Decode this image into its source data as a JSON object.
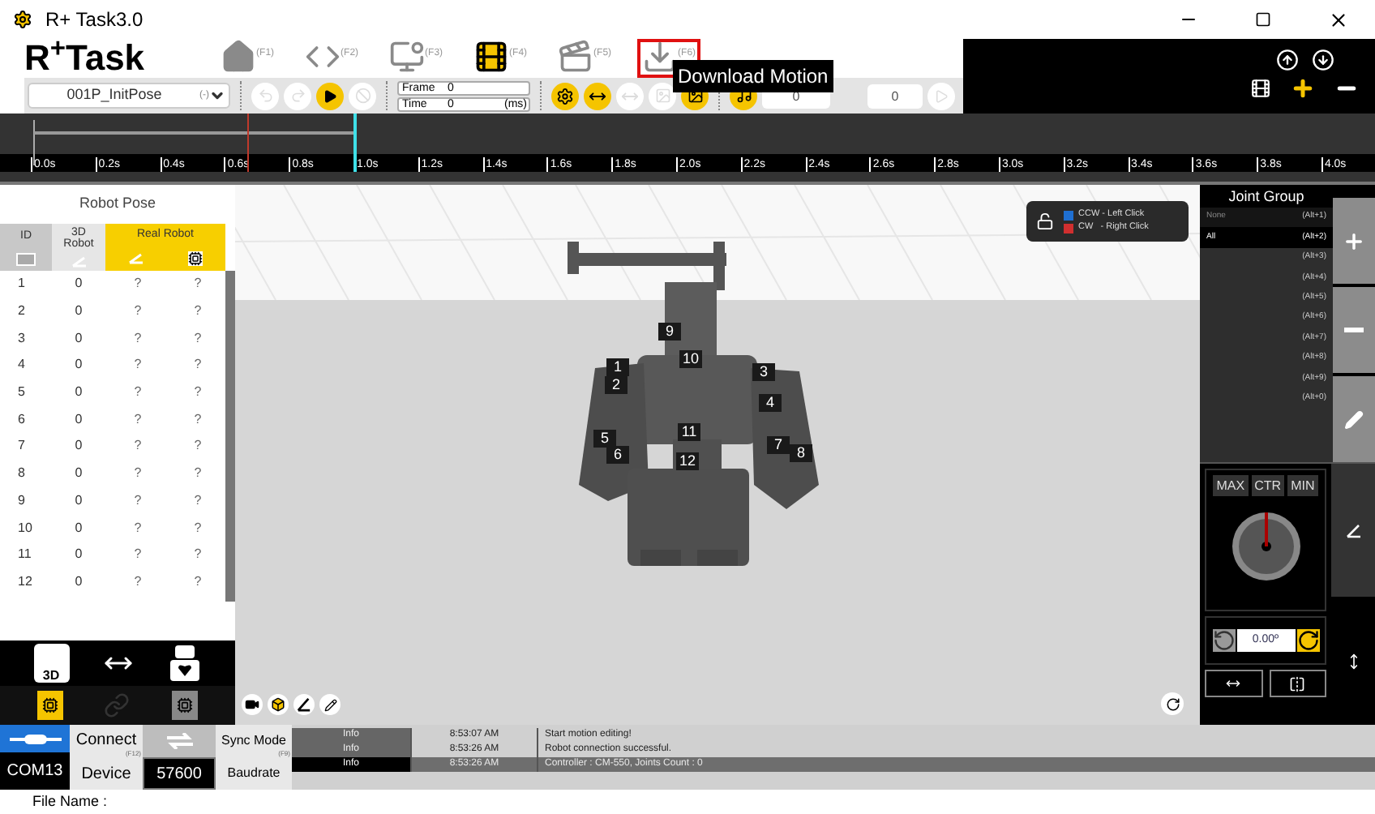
{
  "window": {
    "title": "R+ Task3.0"
  },
  "logo": "R$^{+}$Task",
  "nav": [
    {
      "kind": "home",
      "shortcut": "(F1)",
      "highlighted": false
    },
    {
      "kind": "code",
      "shortcut": "(F2)",
      "highlighted": false
    },
    {
      "kind": "alert",
      "shortcut": "(F3)",
      "highlighted": false
    },
    {
      "kind": "film",
      "shortcut": "(F4)",
      "highlighted": false
    },
    {
      "kind": "clapper",
      "shortcut": "(F5)",
      "highlighted": false
    },
    {
      "kind": "download",
      "shortcut": "(F6)",
      "highlighted": true
    }
  ],
  "tooltip": "Download Motion",
  "toolbar": {
    "motion_file": "001P_InitPose",
    "motion_key": "(-)",
    "frame_label": "Frame",
    "frame": "0",
    "time_label": "Time",
    "time": "0",
    "time_unit": "(ms)",
    "value_1": "0",
    "value_2": "0"
  },
  "timeline": {
    "ticks": [
      "0.0s",
      "0.2s",
      "0.4s",
      "0.6s",
      "0.8s",
      "1.0s",
      "1.2s",
      "1.4s",
      "1.6s",
      "1.8s",
      "2.0s",
      "2.2s",
      "2.4s",
      "2.6s",
      "2.8s",
      "3.0s",
      "3.2s",
      "3.4s",
      "3.6s",
      "3.8s",
      "4.0s"
    ]
  },
  "robot_pose": {
    "title": "Robot Pose",
    "columns": [
      "ID",
      "3D Robot",
      "Real Robot"
    ],
    "rows": [
      {
        "id": "1",
        "robot_3d": "0",
        "real": "?",
        "motor": "?"
      },
      {
        "id": "2",
        "robot_3d": "0",
        "real": "?",
        "motor": "?"
      },
      {
        "id": "3",
        "robot_3d": "0",
        "real": "?",
        "motor": "?"
      },
      {
        "id": "4",
        "robot_3d": "0",
        "real": "?",
        "motor": "?"
      },
      {
        "id": "5",
        "robot_3d": "0",
        "real": "?",
        "motor": "?"
      },
      {
        "id": "6",
        "robot_3d": "0",
        "real": "?",
        "motor": "?"
      },
      {
        "id": "7",
        "robot_3d": "0",
        "real": "?",
        "motor": "?"
      },
      {
        "id": "8",
        "robot_3d": "0",
        "real": "?",
        "motor": "?"
      },
      {
        "id": "9",
        "robot_3d": "0",
        "real": "?",
        "motor": "?"
      },
      {
        "id": "10",
        "robot_3d": "0",
        "real": "?",
        "motor": "?"
      },
      {
        "id": "11",
        "robot_3d": "0",
        "real": "?",
        "motor": "?"
      },
      {
        "id": "12",
        "robot_3d": "0",
        "real": "?",
        "motor": "?"
      }
    ],
    "robot_3d_label": "3D"
  },
  "viewport": {
    "legend": [
      {
        "color": "#1f6fd1",
        "text": "CCW - Left Click"
      },
      {
        "color": "#d02f2f",
        "text": "CW   - Right Click"
      }
    ],
    "joint_labels": [
      "9",
      "10",
      "1",
      "3",
      "2",
      "4",
      "5",
      "6",
      "11",
      "7",
      "8",
      "12"
    ]
  },
  "joint_group": {
    "title": "Joint Group",
    "items": [
      {
        "name": "None",
        "shortcut": "(Alt+1)",
        "selected": false
      },
      {
        "name": "All",
        "shortcut": "(Alt+2)",
        "selected": true
      },
      {
        "shortcut": "(Alt+3)",
        "selected": false
      },
      {
        "shortcut": "(Alt+4)",
        "selected": false
      },
      {
        "shortcut": "(Alt+5)",
        "selected": false
      },
      {
        "shortcut": "(Alt+6)",
        "selected": false
      },
      {
        "shortcut": "(Alt+7)",
        "selected": false
      },
      {
        "shortcut": "(Alt+8)",
        "selected": false
      },
      {
        "shortcut": "(Alt+9)",
        "selected": false
      },
      {
        "shortcut": "(Alt+0)",
        "selected": false
      }
    ]
  },
  "dial": {
    "buttons": [
      "MAX",
      "CTR",
      "MIN"
    ],
    "angle": "0.00º"
  },
  "connection": {
    "port": "COM13",
    "connect": "Connect",
    "connect_key": "(F12)",
    "device": "Device",
    "baud": "57600",
    "sync": "Sync Mode",
    "sync_key": "(F9)",
    "baudrate": "Baudrate"
  },
  "log": [
    {
      "level": "Info",
      "time": "8:53:07 AM",
      "message": "Start motion editing!",
      "selected": false
    },
    {
      "level": "Info",
      "time": "8:53:26 AM",
      "message": "Robot connection successful.",
      "selected": false
    },
    {
      "level": "Info",
      "time": "8:53:26 AM",
      "message": "Controller : CM-550, Joints Count : 0",
      "selected": true
    }
  ],
  "file_name_label": "File Name :"
}
